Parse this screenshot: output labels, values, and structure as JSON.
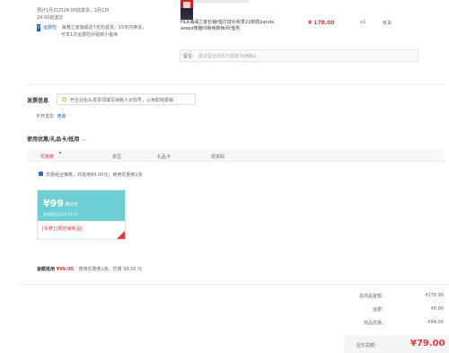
{
  "delivery": {
    "line1": "预计1月31日24:00前发货，2月1日",
    "line2": "24:00前送达",
    "prime_badge": "P",
    "prime_text": "运费险",
    "note1": "海滩之家旗舰店7天内退货，15天内换货，",
    "note2": "可享1次运费险补贴到小金库"
  },
  "product": {
    "name_line1": "HLA海澜之家长袖t恤打底衫秋季22新款panda",
    "name_line2": "wowo熊猫印刷纯棉休闲t恤男",
    "price": "¥ 178.00",
    "qty": "x1",
    "stock": "有货"
  },
  "remark": {
    "label": "留言：",
    "placeholder": "建议留言前先与商家沟通确认"
  },
  "invoice": {
    "title": "发票信息",
    "tip": "开企业抬头发票须填写纳税人识别号，以免影响报销",
    "status": "不开发票",
    "edit": "修改"
  },
  "coupons": {
    "title": "使用优惠/礼品卡/抵用",
    "caret": "︿",
    "tabs": [
      {
        "label": "优惠券",
        "active": true
      },
      {
        "label": "京豆",
        "active": false
      },
      {
        "label": "礼品卡",
        "active": false
      },
      {
        "label": "领货码",
        "active": false
      }
    ],
    "combo_text": "优惠组合推荐，共抵用99.00元；使用优惠券1张",
    "card": {
      "amount": "¥99",
      "condition": "满158",
      "expiry": "有效期至2024-01-31",
      "tags": "[东券] [限店铺商品]"
    },
    "summary_prefix": "金额抵用",
    "summary_amount": "¥99.00",
    "summary_suffix": "使用优惠券1张，优惠 99.00 元"
  },
  "totals": {
    "rows": [
      {
        "label": "总商品金额：",
        "value": "¥178.00"
      },
      {
        "label": "运费：",
        "value": "¥0.00"
      },
      {
        "label": "商品优惠：",
        "value": "-¥99.00"
      }
    ],
    "payable_label": "应付总额：",
    "payable_value": "¥79.00"
  },
  "colors": {
    "accent": "#e4393c",
    "link": "#1e5fb3",
    "coupon": "#6dcfd3"
  }
}
